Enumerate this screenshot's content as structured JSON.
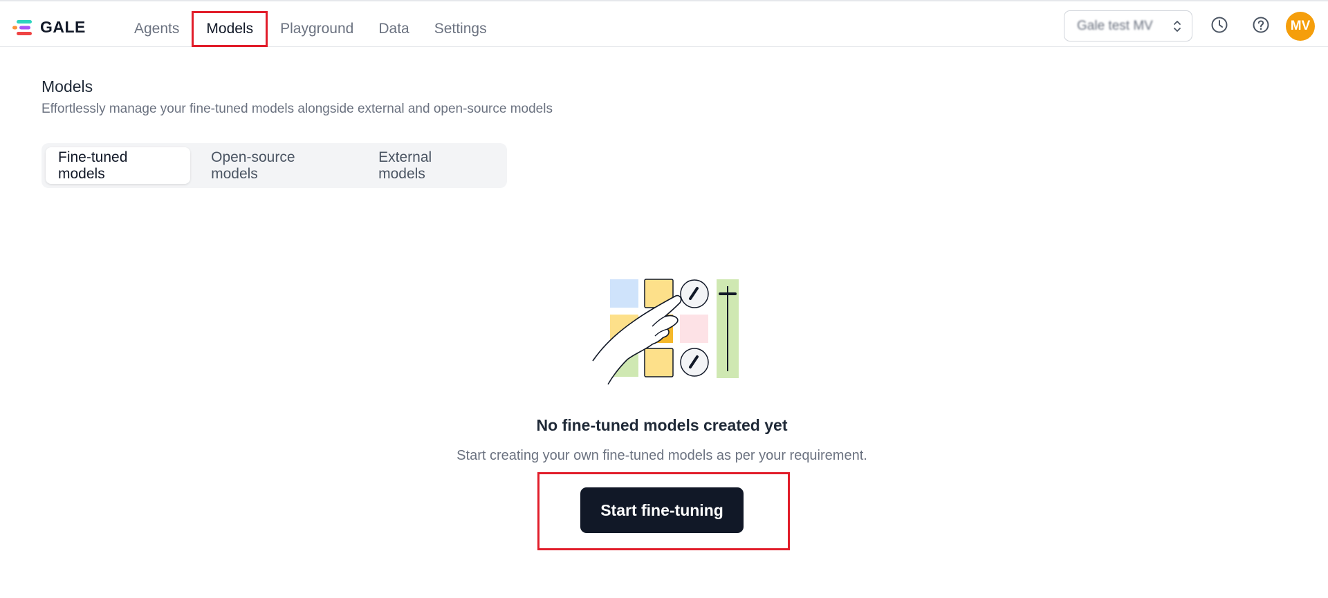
{
  "app": {
    "brand": "GALE",
    "logo_icon": "gale-logo-icon",
    "colors": {
      "accent": "#111827",
      "highlight": "#e11d2a",
      "avatar": "#f59e0b"
    }
  },
  "nav": {
    "items": [
      {
        "label": "Agents"
      },
      {
        "label": "Models",
        "active": true
      },
      {
        "label": "Playground"
      },
      {
        "label": "Data"
      },
      {
        "label": "Settings"
      }
    ]
  },
  "header": {
    "workspace": {
      "name": "Gale test MV",
      "icon": "chevron-up-down-icon"
    },
    "history_icon": "clock-icon",
    "help_icon": "help-icon",
    "avatar_initials": "MV"
  },
  "page": {
    "title": "Models",
    "subtitle": "Effortlessly manage your fine-tuned models alongside external and open-source models"
  },
  "tabs": [
    {
      "label": "Fine-tuned models",
      "active": true
    },
    {
      "label": "Open-source models"
    },
    {
      "label": "External models"
    }
  ],
  "empty_state": {
    "illustration": "hand-pressing-controls-illustration",
    "title": "No fine-tuned models created yet",
    "description": "Start creating your own fine-tuned models as per your requirement.",
    "button_label": "Start fine-tuning"
  }
}
